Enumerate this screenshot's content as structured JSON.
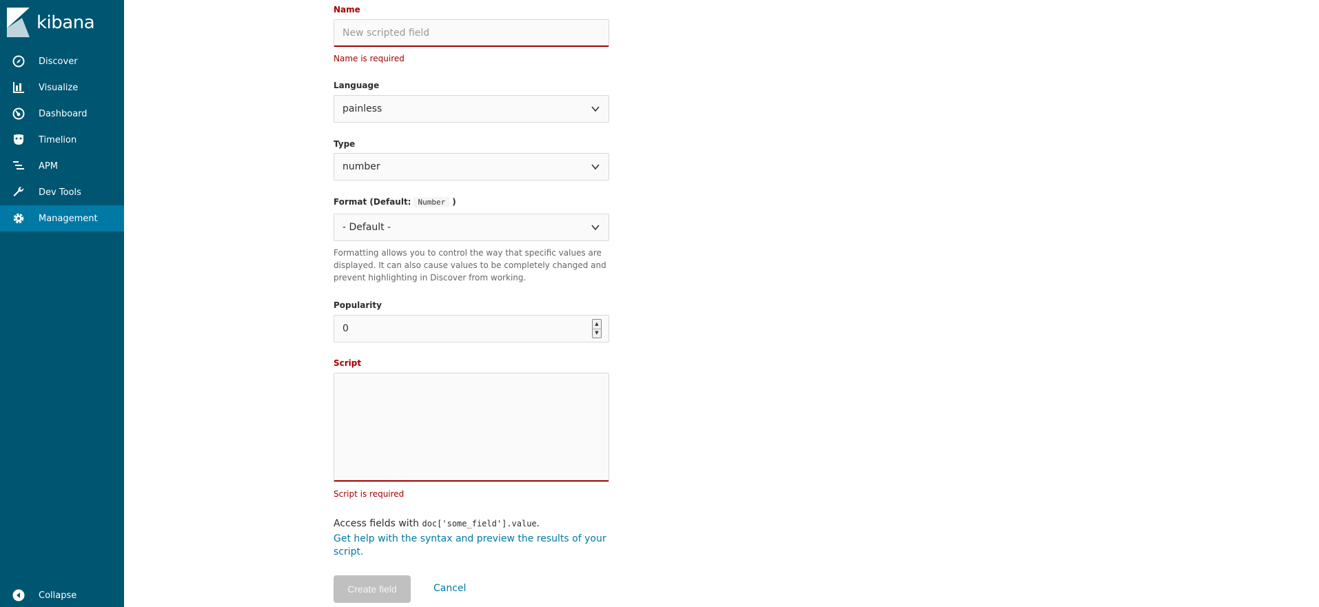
{
  "app": {
    "logo_text": "kibana"
  },
  "sidebar": {
    "items": [
      {
        "label": "Discover",
        "icon": "compass-icon"
      },
      {
        "label": "Visualize",
        "icon": "bar-chart-icon"
      },
      {
        "label": "Dashboard",
        "icon": "dashboard-gauge-icon"
      },
      {
        "label": "Timelion",
        "icon": "timelion-mask-icon"
      },
      {
        "label": "APM",
        "icon": "apm-bars-icon"
      },
      {
        "label": "Dev Tools",
        "icon": "wrench-icon"
      },
      {
        "label": "Management",
        "icon": "gear-icon",
        "active": true
      }
    ],
    "collapse_label": "Collapse"
  },
  "form": {
    "name": {
      "label": "Name",
      "placeholder": "New scripted field",
      "error": "Name is required"
    },
    "language": {
      "label": "Language",
      "value": "painless"
    },
    "type": {
      "label": "Type",
      "value": "number"
    },
    "format": {
      "label": "Format (Default:",
      "default_badge": "Number",
      "label_close": ")",
      "value": "- Default -",
      "help": "Formatting allows you to control the way that specific values are displayed. It can also cause values to be completely changed and prevent highlighting in Discover from working."
    },
    "popularity": {
      "label": "Popularity",
      "value": "0"
    },
    "script": {
      "label": "Script",
      "error": "Script is required"
    },
    "access": {
      "prefix": "Access fields with",
      "code": "doc['some_field'].value",
      "suffix": "."
    },
    "help_link": "Get help with the syntax and preview the results of your script.",
    "create_button": "Create field",
    "cancel_button": "Cancel"
  },
  "colors": {
    "sidebar_bg": "#005571",
    "active_bg": "#0079a5",
    "error": "#a30000",
    "link": "#0079a5"
  }
}
